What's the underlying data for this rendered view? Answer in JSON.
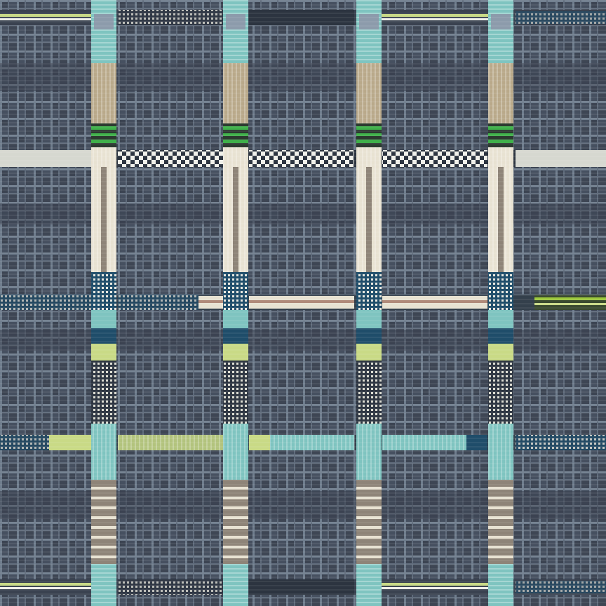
{
  "image": {
    "subject": "woven-fabric-swatch",
    "pattern": "plaid-grid",
    "colors": {
      "base_dark": "#404855",
      "base_mid": "#5a6474",
      "grid_light": "#6f7d8d",
      "grid_pale": "#8c9bab",
      "teal": "#7fc4c0",
      "teal_dark": "#3d8f8c",
      "tan": "#b9a98a",
      "cream": "#e8e2d2",
      "lime": "#c9da86",
      "green": "#3fb04a",
      "navy": "#1f4d6a",
      "white": "#f0f0ea",
      "taupe": "#8e8478"
    }
  }
}
